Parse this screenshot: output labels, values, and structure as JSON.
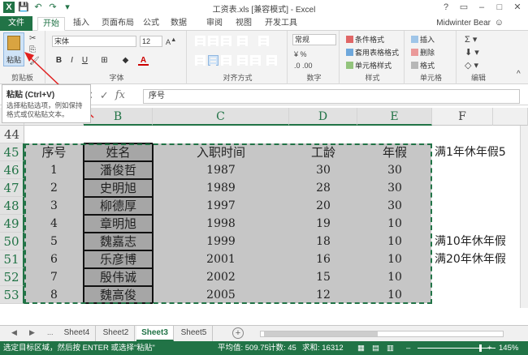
{
  "window": {
    "title": "工资表.xls  [兼容模式] - Excel",
    "help": "?",
    "restore": "▭",
    "minimize": "–",
    "maximize": "□",
    "close": "✕"
  },
  "qat": {
    "save": "💾",
    "undo": "↶",
    "redo": "↷",
    "more": "▾"
  },
  "tabs": {
    "file": "文件",
    "items": [
      "开始",
      "插入",
      "页面布局",
      "公式",
      "数据",
      "审阅",
      "视图",
      "开发工具"
    ],
    "user": "Midwinter Bear"
  },
  "ribbon": {
    "paste_label": "粘贴",
    "clipboard_label": "剪贴板",
    "font_name": "宋体",
    "font_size": "12",
    "font_label": "字体",
    "align_label": "对齐方式",
    "number_format": "常规",
    "number_label": "数字",
    "cond_format": "条件格式",
    "table_format": "套用表格格式",
    "cell_style": "单元格样式",
    "style_label": "样式",
    "insert": "插入",
    "delete": "删除",
    "format": "格式",
    "cells_label": "单元格",
    "edit_label": "编辑",
    "bold": "B",
    "italic": "I",
    "underline": "U"
  },
  "tooltip": {
    "title": "粘贴 (Ctrl+V)",
    "desc": "选择粘贴选项，例如保持格式或仅粘贴文本。"
  },
  "formula_bar": {
    "cancel": "✕",
    "confirm": "✓",
    "fx": "fx",
    "value": "序号"
  },
  "grid": {
    "columns": [
      "B",
      "C",
      "D",
      "E",
      "F"
    ],
    "rows": [
      "44",
      "45",
      "46",
      "47",
      "48",
      "49",
      "50",
      "51",
      "52",
      "53"
    ],
    "headers": [
      "序号",
      "姓名",
      "入职时间",
      "工龄",
      "年假"
    ],
    "data": [
      [
        "1",
        "潘俊哲",
        "1987",
        "30",
        "30"
      ],
      [
        "2",
        "史明旭",
        "1989",
        "28",
        "30"
      ],
      [
        "3",
        "柳德厚",
        "1997",
        "20",
        "30"
      ],
      [
        "4",
        "章明旭",
        "1998",
        "19",
        "10"
      ],
      [
        "5",
        "魏嘉志",
        "1999",
        "18",
        "10"
      ],
      [
        "6",
        "乐彦博",
        "2001",
        "16",
        "10"
      ],
      [
        "7",
        "殷伟诚",
        "2002",
        "15",
        "10"
      ],
      [
        "8",
        "魏高俊",
        "2005",
        "12",
        "10"
      ]
    ],
    "notes": [
      "满1年休年假5",
      "满10年休年假",
      "满20年休年假"
    ]
  },
  "sheets": {
    "tabs": [
      "Sheet4",
      "Sheet2",
      "Sheet3",
      "Sheet5"
    ],
    "nav_prev": "◀",
    "nav_next": "▶",
    "ellipsis": "...",
    "add": "+"
  },
  "status": {
    "message": "选定目标区域，然后按 ENTER 或选择\"粘贴\"",
    "average": "平均值: 509.75",
    "count": "计数: 45",
    "sum": "求和: 16312",
    "zoom": "145%"
  }
}
